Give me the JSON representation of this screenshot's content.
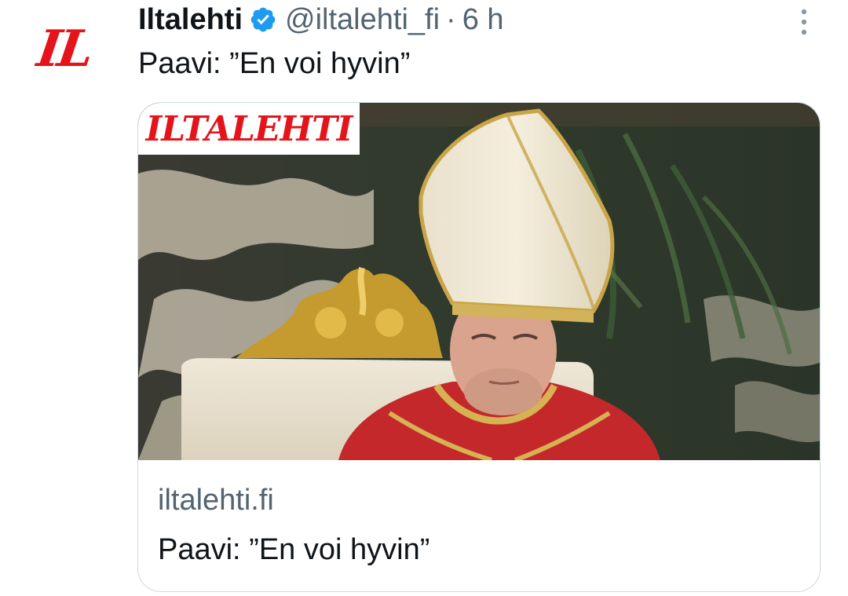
{
  "account": {
    "avatar_text": "IL",
    "display_name": "Iltalehti",
    "verified": true,
    "handle": "@iltalehti_fi",
    "separator": "·",
    "time": "6 h"
  },
  "tweet": {
    "text": "Paavi: ”En voi hyvin”"
  },
  "card": {
    "image_brand": "ILTALEHTI",
    "domain": "iltalehti.fi",
    "title": "Paavi: ”En voi hyvin”"
  },
  "colors": {
    "brand_red": "#e5141b",
    "verified_blue": "#1d9bf0",
    "text_primary": "#0f1419",
    "text_secondary": "#536471",
    "border": "#cfd9de"
  },
  "icons": {
    "verified": "verified-badge-icon",
    "more": "more-options-icon"
  }
}
